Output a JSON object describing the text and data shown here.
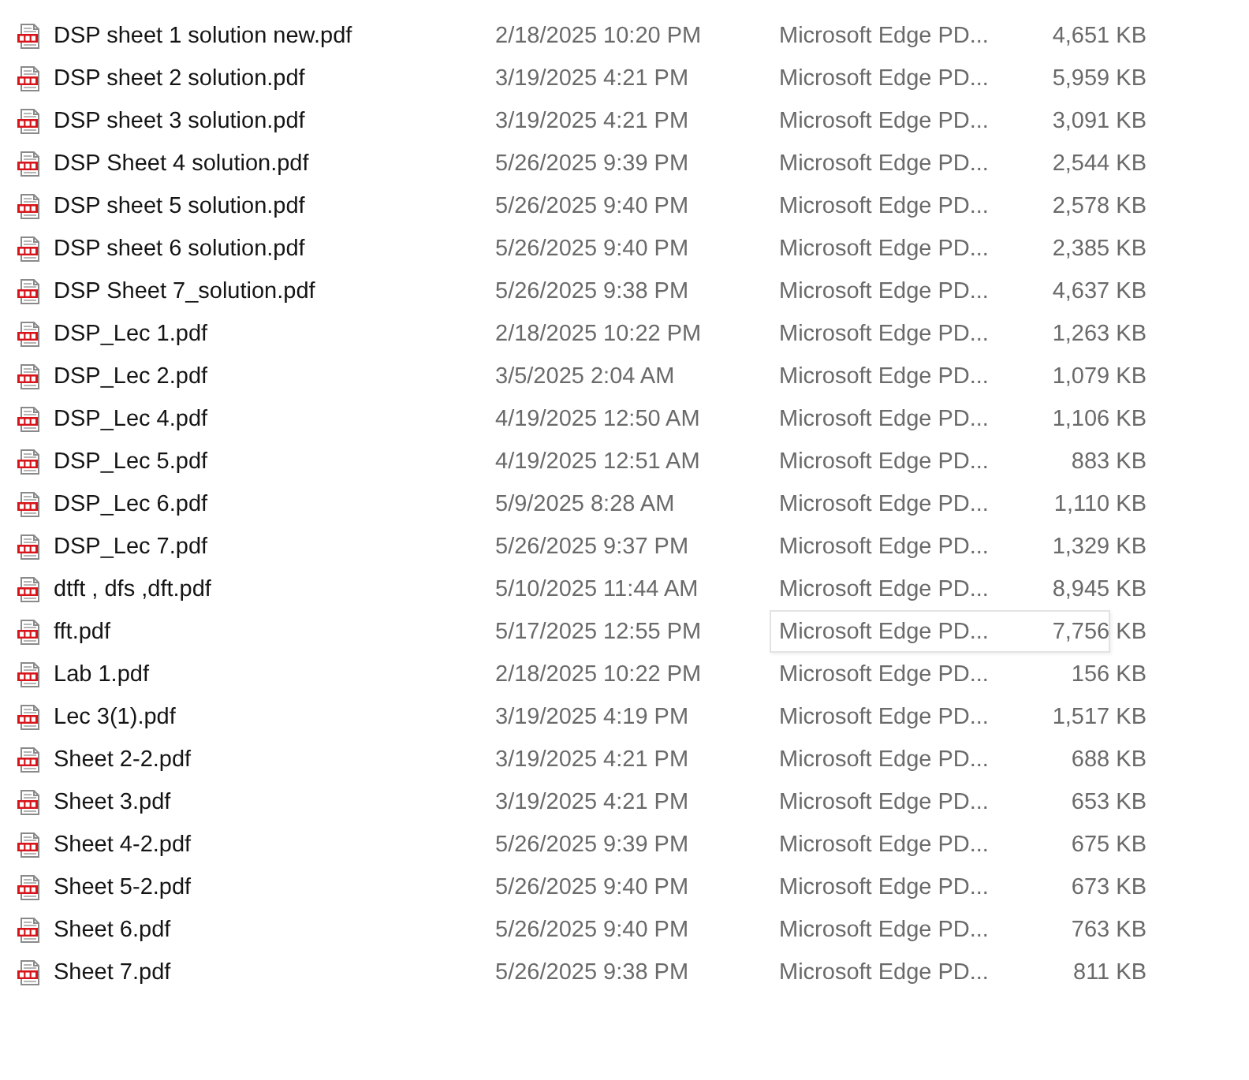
{
  "files": [
    {
      "name": "DSP sheet 1 solution new.pdf",
      "modified": "2/18/2025 10:20 PM",
      "type": "Microsoft Edge PD...",
      "size": "4,651 KB",
      "tooltip": false
    },
    {
      "name": "DSP sheet 2 solution.pdf",
      "modified": "3/19/2025 4:21 PM",
      "type": "Microsoft Edge PD...",
      "size": "5,959 KB",
      "tooltip": false
    },
    {
      "name": "DSP sheet 3 solution.pdf",
      "modified": "3/19/2025 4:21 PM",
      "type": "Microsoft Edge PD...",
      "size": "3,091 KB",
      "tooltip": false
    },
    {
      "name": "DSP Sheet 4 solution.pdf",
      "modified": "5/26/2025 9:39 PM",
      "type": "Microsoft Edge PD...",
      "size": "2,544 KB",
      "tooltip": false
    },
    {
      "name": "DSP sheet 5 solution.pdf",
      "modified": "5/26/2025 9:40 PM",
      "type": "Microsoft Edge PD...",
      "size": "2,578 KB",
      "tooltip": false
    },
    {
      "name": "DSP sheet 6 solution.pdf",
      "modified": "5/26/2025 9:40 PM",
      "type": "Microsoft Edge PD...",
      "size": "2,385 KB",
      "tooltip": false
    },
    {
      "name": "DSP Sheet 7_solution.pdf",
      "modified": "5/26/2025 9:38 PM",
      "type": "Microsoft Edge PD...",
      "size": "4,637 KB",
      "tooltip": false
    },
    {
      "name": "DSP_Lec 1.pdf",
      "modified": "2/18/2025 10:22 PM",
      "type": "Microsoft Edge PD...",
      "size": "1,263 KB",
      "tooltip": false
    },
    {
      "name": "DSP_Lec 2.pdf",
      "modified": "3/5/2025 2:04 AM",
      "type": "Microsoft Edge PD...",
      "size": "1,079 KB",
      "tooltip": false
    },
    {
      "name": "DSP_Lec 4.pdf",
      "modified": "4/19/2025 12:50 AM",
      "type": "Microsoft Edge PD...",
      "size": "1,106 KB",
      "tooltip": false
    },
    {
      "name": "DSP_Lec 5.pdf",
      "modified": "4/19/2025 12:51 AM",
      "type": "Microsoft Edge PD...",
      "size": "883 KB",
      "tooltip": false
    },
    {
      "name": "DSP_Lec 6.pdf",
      "modified": "5/9/2025 8:28 AM",
      "type": "Microsoft Edge PD...",
      "size": "1,110 KB",
      "tooltip": false
    },
    {
      "name": "DSP_Lec 7.pdf",
      "modified": "5/26/2025 9:37 PM",
      "type": "Microsoft Edge PD...",
      "size": "1,329 KB",
      "tooltip": false
    },
    {
      "name": "dtft , dfs ,dft.pdf",
      "modified": "5/10/2025 11:44 AM",
      "type": "Microsoft Edge PD...",
      "size": "8,945 KB",
      "tooltip": false
    },
    {
      "name": "fft.pdf",
      "modified": "5/17/2025 12:55 PM",
      "type": "Microsoft Edge PD...",
      "size": "7,756 KB",
      "tooltip": true
    },
    {
      "name": "Lab 1.pdf",
      "modified": "2/18/2025 10:22 PM",
      "type": "Microsoft Edge PD...",
      "size": "156 KB",
      "tooltip": false
    },
    {
      "name": "Lec 3(1).pdf",
      "modified": "3/19/2025 4:19 PM",
      "type": "Microsoft Edge PD...",
      "size": "1,517 KB",
      "tooltip": false
    },
    {
      "name": "Sheet 2-2.pdf",
      "modified": "3/19/2025 4:21 PM",
      "type": "Microsoft Edge PD...",
      "size": "688 KB",
      "tooltip": false
    },
    {
      "name": "Sheet 3.pdf",
      "modified": "3/19/2025 4:21 PM",
      "type": "Microsoft Edge PD...",
      "size": "653 KB",
      "tooltip": false
    },
    {
      "name": "Sheet 4-2.pdf",
      "modified": "5/26/2025 9:39 PM",
      "type": "Microsoft Edge PD...",
      "size": "675 KB",
      "tooltip": false
    },
    {
      "name": "Sheet 5-2.pdf",
      "modified": "5/26/2025 9:40 PM",
      "type": "Microsoft Edge PD...",
      "size": "673 KB",
      "tooltip": false
    },
    {
      "name": "Sheet 6.pdf",
      "modified": "5/26/2025 9:40 PM",
      "type": "Microsoft Edge PD...",
      "size": "763 KB",
      "tooltip": false
    },
    {
      "name": "Sheet 7.pdf",
      "modified": "5/26/2025 9:38 PM",
      "type": "Microsoft Edge PD...",
      "size": "811 KB",
      "tooltip": false
    }
  ]
}
